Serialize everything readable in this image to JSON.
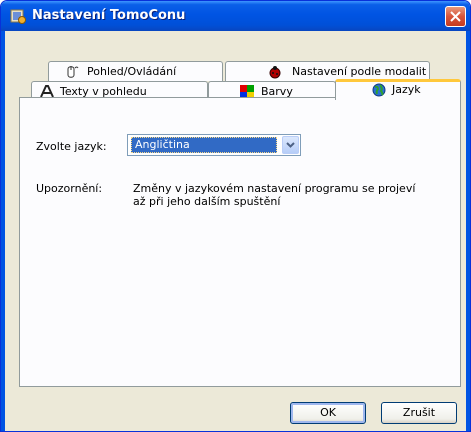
{
  "window": {
    "title": "Nastavení TomoConu"
  },
  "tabs": {
    "row_back": [
      {
        "label": "Pohled/Ovládání",
        "icon": "mouse-icon"
      },
      {
        "label": "Nastavení podle modalit",
        "icon": "ladybug-icon"
      }
    ],
    "row_front": [
      {
        "label": "Texty v pohledu",
        "icon": "text-a-icon"
      },
      {
        "label": "Barvy",
        "icon": "color-squares-icon"
      },
      {
        "label": "Jazyk",
        "icon": "globe-icon",
        "active": true
      }
    ]
  },
  "language": {
    "label": "Zvolte jazyk:",
    "selected": "Angličtina"
  },
  "notice": {
    "label": "Upozornění:",
    "text_line1": "Změny v jazykovém nastavení programu se projeví",
    "text_line2": "až při jeho dalším spuštění"
  },
  "buttons": {
    "ok": "OK",
    "cancel": "Zrušit"
  },
  "colors": {
    "titlebar": "#0054e3",
    "selection": "#316ac5",
    "active_tab_accent": "#ffc83c",
    "close_button": "#d7543b"
  }
}
